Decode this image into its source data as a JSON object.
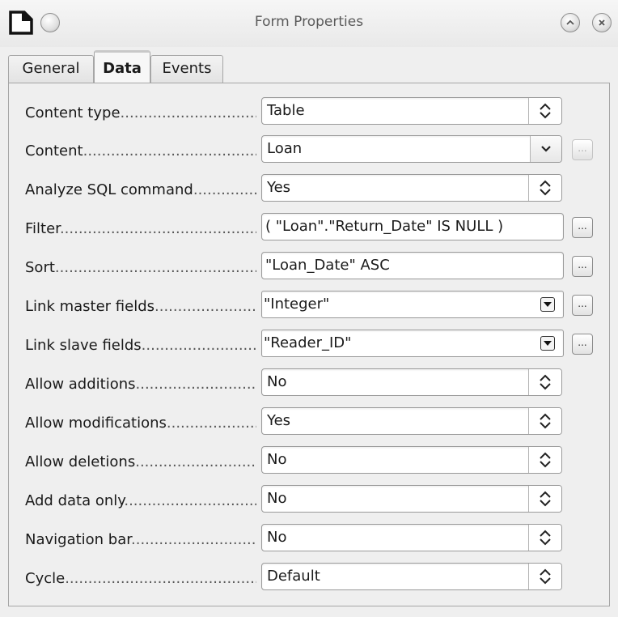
{
  "window": {
    "title": "Form Properties",
    "icons": [
      "app-document-icon",
      "window-menu-icon",
      "shade-icon",
      "close-icon"
    ]
  },
  "tabs": [
    {
      "label": "General",
      "active": false
    },
    {
      "label": "Data",
      "active": true
    },
    {
      "label": "Events",
      "active": false
    }
  ],
  "fields": {
    "content_type": {
      "label": "Content type",
      "value": "Table"
    },
    "content": {
      "label": "Content",
      "value": "Loan",
      "more_label": "..."
    },
    "analyze_sql": {
      "label": "Analyze SQL command",
      "value": "Yes"
    },
    "filter": {
      "label": "Filter",
      "value": "( \"Loan\".\"Return_Date\" IS NULL )",
      "more_label": "..."
    },
    "sort": {
      "label": "Sort",
      "value": "\"Loan_Date\" ASC",
      "more_label": "..."
    },
    "link_master": {
      "label": "Link master fields",
      "value": "\"Integer\"",
      "more_label": "..."
    },
    "link_slave": {
      "label": "Link slave fields",
      "value": "\"Reader_ID\"",
      "more_label": "..."
    },
    "allow_additions": {
      "label": "Allow additions",
      "value": "No"
    },
    "allow_modifications": {
      "label": "Allow modifications",
      "value": "Yes"
    },
    "allow_deletions": {
      "label": "Allow deletions",
      "value": "No"
    },
    "add_data_only": {
      "label": "Add data only",
      "value": "No"
    },
    "navigation_bar": {
      "label": "Navigation bar",
      "value": "No"
    },
    "cycle": {
      "label": "Cycle",
      "value": "Default"
    }
  }
}
